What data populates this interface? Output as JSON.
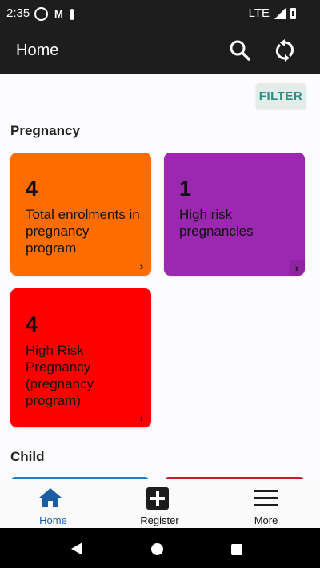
{
  "status": {
    "time": "2:35",
    "network": "LTE"
  },
  "appbar": {
    "title": "Home"
  },
  "filter": {
    "label": "FILTER"
  },
  "sections": {
    "pregnancy": "Pregnancy",
    "child": "Child"
  },
  "cards": [
    {
      "count": "4",
      "label": "Total enrolments in pregnancy program",
      "color": "#ff6d00"
    },
    {
      "count": "1",
      "label": "High risk pregnancies",
      "color": "#9c27b0"
    },
    {
      "count": "4",
      "label": "High Risk Pregnancy (pregnancy program)",
      "color": "#ff0000"
    }
  ],
  "nav": {
    "home": "Home",
    "register": "Register",
    "more": "More"
  },
  "colors": {
    "accent_home": "#1a5da3",
    "filter_text": "#2b8c82",
    "child_card_1": "#1a7fc4",
    "child_card_2": "#c41e2e"
  }
}
